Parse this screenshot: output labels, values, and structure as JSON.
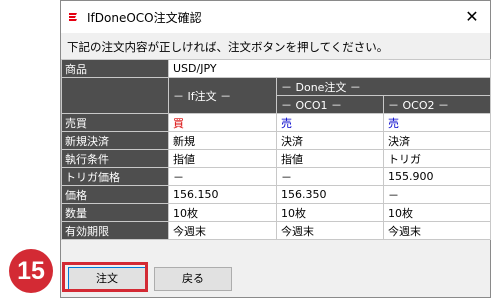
{
  "window": {
    "title": "IfDoneOCO注文確認",
    "close_glyph": "✕",
    "icon": "app-logo-icon"
  },
  "instruction": "下記の注文内容が正しければ、注文ボタンを押してください。",
  "symbol": {
    "label": "商品",
    "value": "USD/JPY"
  },
  "headers": {
    "if": "－ If注文 －",
    "done": "－ Done注文 －",
    "oco1": "－ OCO1 －",
    "oco2": "－ OCO2 －"
  },
  "rows": [
    {
      "label": "売買",
      "if": "買",
      "oco1": "売",
      "oco2": "売"
    },
    {
      "label": "新規決済",
      "if": "新規",
      "oco1": "決済",
      "oco2": "決済"
    },
    {
      "label": "執行条件",
      "if": "指値",
      "oco1": "指値",
      "oco2": "トリガ"
    },
    {
      "label": "トリガ価格",
      "if": "－",
      "oco1": "－",
      "oco2": "155.900"
    },
    {
      "label": "価格",
      "if": "156.150",
      "oco1": "156.350",
      "oco2": "－"
    },
    {
      "label": "数量",
      "if": "10枚",
      "oco1": "10枚",
      "oco2": "10枚"
    },
    {
      "label": "有効期限",
      "if": "今週末",
      "oco1": "今週末",
      "oco2": "今週末"
    }
  ],
  "buttons": {
    "order": "注文",
    "back": "戻る"
  },
  "annotation": {
    "step_number": "15"
  },
  "colors": {
    "buy": "#d80000",
    "sell": "#0000cc",
    "highlight": "#d32a34",
    "header_bg": "#4e4e4e"
  }
}
